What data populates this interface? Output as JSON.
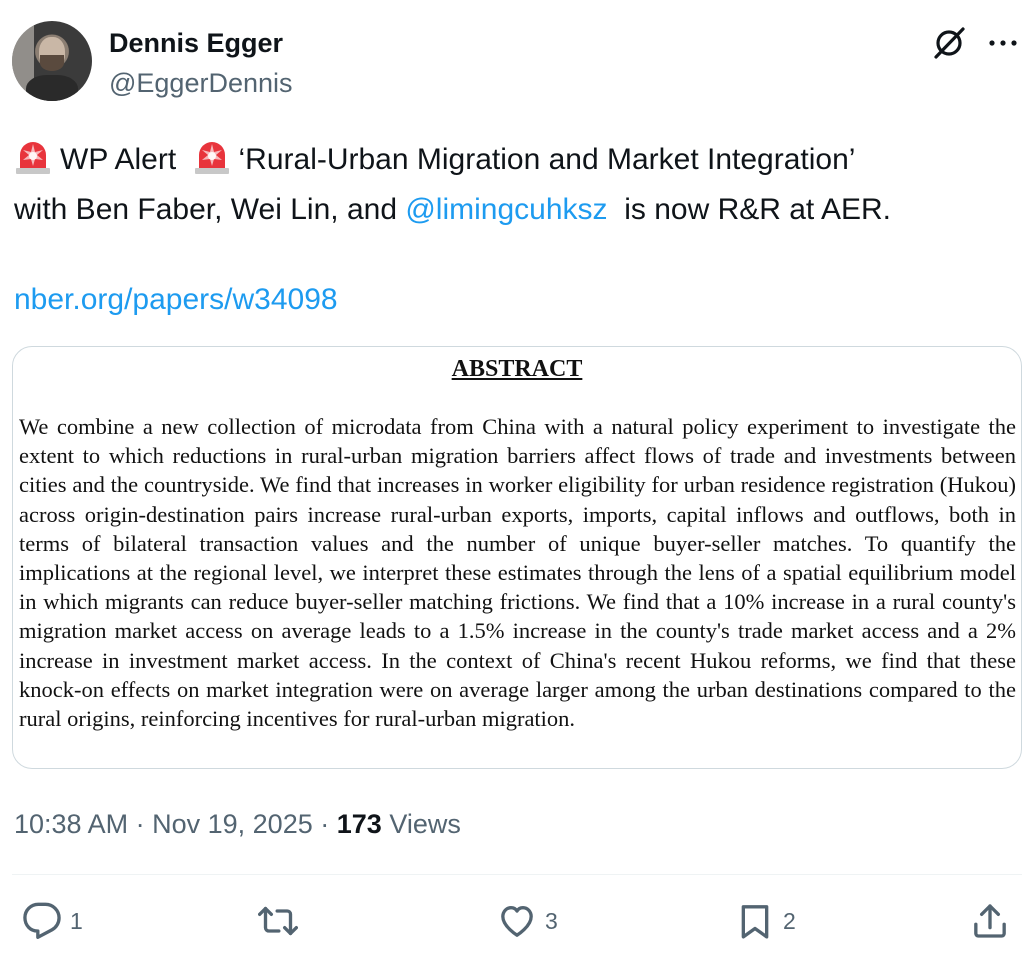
{
  "author": {
    "name": "Dennis Egger",
    "handle": "@EggerDennis"
  },
  "tweet": {
    "alert_label": "WP Alert",
    "title_quote": "‘Rural-Urban Migration and Market Integration’",
    "text_before_mention": "with Ben Faber, Wei Lin, and",
    "mention": "@limingcuhksz",
    "text_after_mention": "is now R&R at AER.",
    "link": "nber.org/papers/w34098"
  },
  "card": {
    "heading": "ABSTRACT",
    "body": "We combine a new collection of microdata from China with a natural policy experiment to investigate the extent to which reductions in rural-urban migration barriers affect flows of trade and investments between cities and the countryside. We find that increases in worker eligibility for urban residence registration (Hukou) across origin-destination pairs increase rural-urban exports, imports, capital inflows and outflows, both in terms of bilateral transaction values and the number of unique buyer-seller matches. To quantify the implications at the regional level, we interpret these estimates through the lens of a spatial equilibrium model in which migrants can reduce buyer-seller matching frictions. We find that a 10% increase in a rural county's migration market access on average leads to a 1.5% increase in the county's trade market access and a 2% increase in investment market access. In the context of China's recent Hukou reforms, we find that these knock-on effects on market integration were on average larger among the urban destinations compared to the rural origins, reinforcing incentives for rural-urban migration."
  },
  "meta": {
    "time": "10:38 AM",
    "separator": "·",
    "date": "Nov 19, 2025",
    "views_count": "173",
    "views_label": "Views"
  },
  "actions": {
    "replies": "1",
    "reposts": "",
    "likes": "3",
    "bookmarks": "2"
  },
  "icons": {
    "header": [
      "grok-icon",
      "more-icon"
    ],
    "inline": "police-siren-icon",
    "actions": [
      "reply-icon",
      "repost-icon",
      "like-icon",
      "bookmark-icon",
      "share-icon"
    ]
  },
  "colors": {
    "link": "#1d9bf0",
    "secondary_text": "#536471",
    "primary_text": "#0f1419",
    "siren_red": "#e8343c"
  }
}
